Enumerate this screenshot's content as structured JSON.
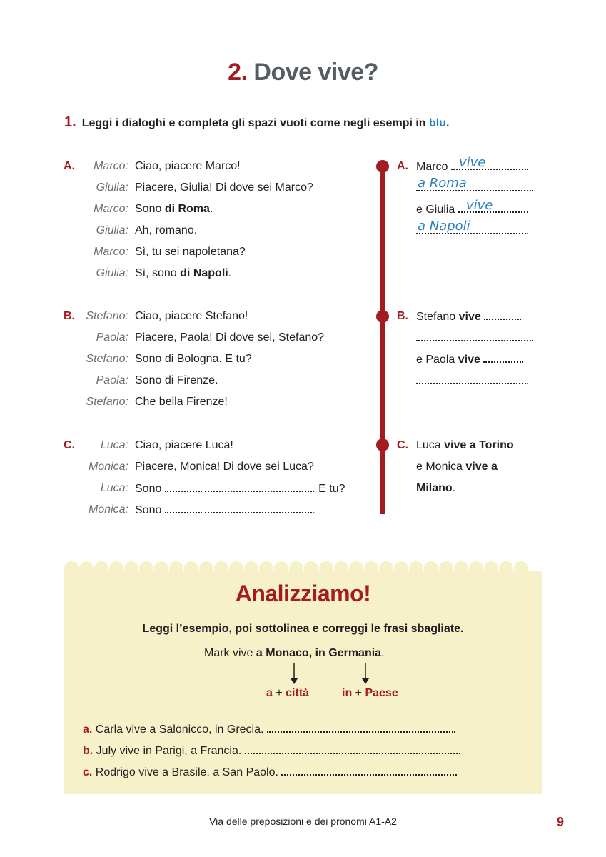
{
  "title": {
    "number": "2.",
    "text": "Dove vive?"
  },
  "instruction": {
    "number": "1.",
    "text": "Leggi i dialoghi e completa gli spazi vuoti come negli esempi in ",
    "blue": "blu",
    "end": "."
  },
  "dialogues": {
    "a": {
      "label": "A.",
      "lines": [
        {
          "speaker": "Marco:",
          "text": "Ciao, piacere Marco!"
        },
        {
          "speaker": "Giulia:",
          "text": "Piacere, Giulia! Di dove sei Marco?"
        },
        {
          "speaker": "Marco:",
          "pre": "Sono ",
          "bold": "di Roma",
          "post": "."
        },
        {
          "speaker": "Giulia:",
          "text": "Ah, romano."
        },
        {
          "speaker": "Marco:",
          "text": "Sì, tu sei napoletana?"
        },
        {
          "speaker": "Giulia:",
          "pre": "Sì, sono ",
          "bold": "di Napoli",
          "post": "."
        }
      ]
    },
    "b": {
      "label": "B.",
      "lines": [
        {
          "speaker": "Stefano:",
          "text": "Ciao, piacere Stefano!"
        },
        {
          "speaker": "Paola:",
          "text": "Piacere, Paola! Di dove sei, Stefano?"
        },
        {
          "speaker": "Stefano:",
          "text": "Sono di Bologna. E tu?"
        },
        {
          "speaker": "Paola:",
          "text": "Sono di Firenze."
        },
        {
          "speaker": "Stefano:",
          "text": "Che bella Firenze!"
        }
      ]
    },
    "c": {
      "label": "C.",
      "lines": [
        {
          "speaker": "Luca:",
          "text": "Ciao, piacere Luca!"
        },
        {
          "speaker": "Monica:",
          "text": "Piacere, Monica! Di dove sei Luca?"
        },
        {
          "speaker": "Luca:",
          "pre": "Sono",
          "post": ". E tu?"
        },
        {
          "speaker": "Monica:",
          "pre": "Sono",
          "post": "."
        }
      ]
    }
  },
  "answers": {
    "a": {
      "label": "A.",
      "name1": "Marco",
      "hand1": "vive",
      "hand2": "a Roma",
      "name2": "e Giulia",
      "hand3": "vive",
      "hand4": "a Napoli",
      "end": "."
    },
    "b": {
      "label": "B.",
      "name1": "Stefano",
      "verb1": "vive",
      "name2": "e Paola",
      "verb2": "vive",
      "end": "."
    },
    "c": {
      "label": "C.",
      "name1": "Luca",
      "bold1": "vive a Torino",
      "name2": "e Monica",
      "bold2": "vive a",
      "bold3": "Milano",
      "end": "."
    }
  },
  "analysis": {
    "title": "Analizziamo!",
    "instruction_pre": "Leggi l’esempio, poi ",
    "instruction_u": "sottolinea",
    "instruction_post": " e correggi le frasi sbagliate.",
    "example_pre": "Mark vive ",
    "example_bold": "a Monaco, in Germania",
    "example_end": ".",
    "rule1_a": "a",
    "rule1_plus": " + ",
    "rule1_b": "città",
    "rule2_a": "in",
    "rule2_plus": " + ",
    "rule2_b": "Paese",
    "items": [
      {
        "label": "a.",
        "text": "Carla vive a Salonicco, in Grecia."
      },
      {
        "label": "b.",
        "text": "July vive in Parigi, a Francia."
      },
      {
        "label": "c.",
        "text": "Rodrigo vive a Brasile, a San Paolo."
      }
    ]
  },
  "footer": {
    "text": "Via delle preposizioni e dei pronomi A1-A2",
    "page": "9"
  }
}
